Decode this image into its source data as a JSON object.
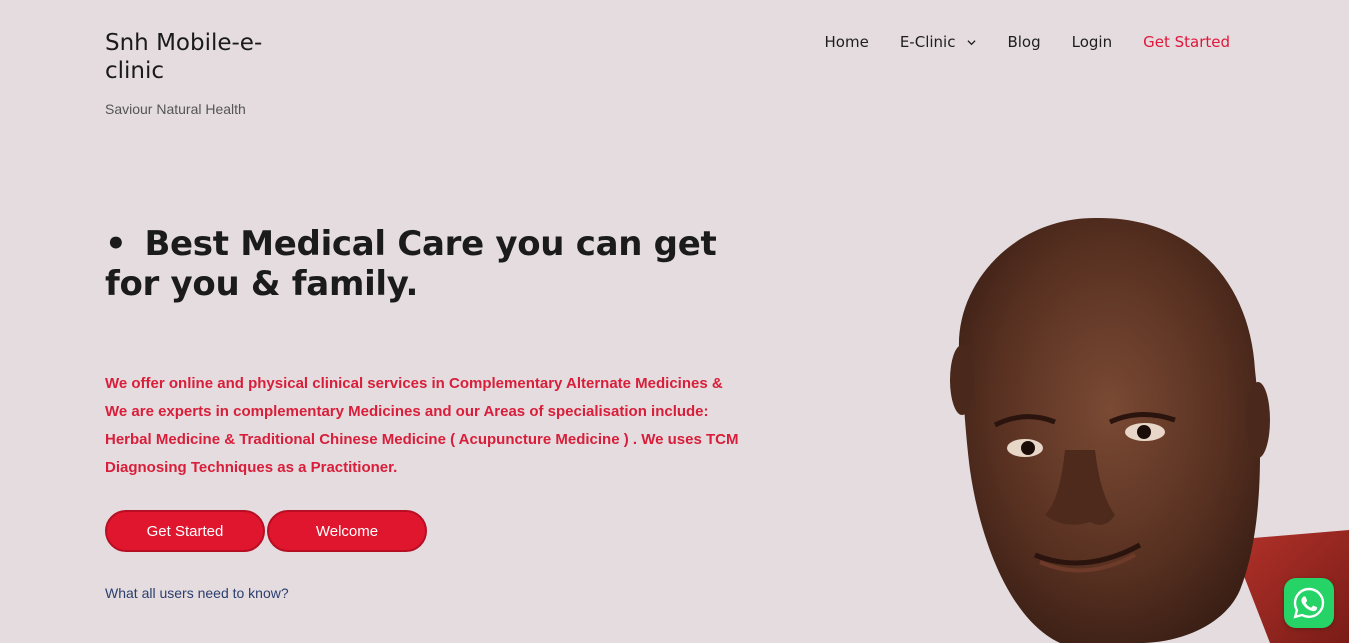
{
  "site": {
    "title": "Snh Mobile-e-clinic",
    "tagline": "Saviour Natural Health"
  },
  "nav": {
    "items": [
      {
        "label": "Home"
      },
      {
        "label": "E-Clinic",
        "icon": "chevron-down-icon"
      },
      {
        "label": "Blog"
      },
      {
        "label": "Login"
      },
      {
        "label": "Get Started",
        "accent": "#e0163b"
      }
    ]
  },
  "hero": {
    "bullet": "•",
    "title": "Best Medical Care you can get for you & family.",
    "description": "We offer online and physical clinical services in Complementary Alternate Medicines & We are experts in complementary Medicines and our Areas of specialisation include: Herbal Medicine & Traditional Chinese Medicine ( Acupuncture Medicine ) . We uses TCM Diagnosing Techniques as a Practitioner.",
    "buttons": [
      {
        "label": "Get Started"
      },
      {
        "label": "Welcome"
      }
    ],
    "help_link": "What all users need to know?"
  },
  "widgets": {
    "whatsapp_icon": "whatsapp-icon"
  },
  "colors": {
    "background": "#e4dcde",
    "accent": "#e0163b",
    "text_red": "#d81e3a",
    "button": "#e0162f",
    "link": "#2b3e6e",
    "whatsapp": "#25d366"
  }
}
